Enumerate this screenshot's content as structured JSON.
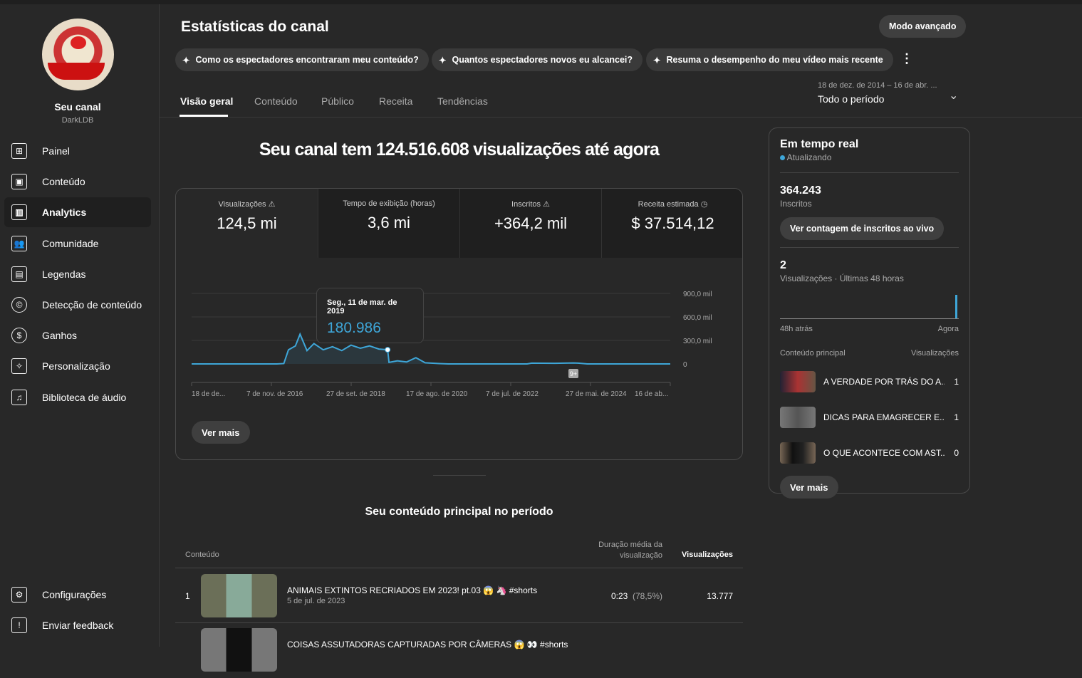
{
  "sidebar": {
    "channel_label": "Seu canal",
    "handle": "DarkLDB",
    "items": [
      {
        "label": "Painel",
        "icon": "dashboard-icon"
      },
      {
        "label": "Conteúdo",
        "icon": "content-icon"
      },
      {
        "label": "Analytics",
        "icon": "analytics-icon"
      },
      {
        "label": "Comunidade",
        "icon": "community-icon"
      },
      {
        "label": "Legendas",
        "icon": "subtitles-icon"
      },
      {
        "label": "Detecção de conteúdo",
        "icon": "copyright-icon"
      },
      {
        "label": "Ganhos",
        "icon": "dollar-icon"
      },
      {
        "label": "Personalização",
        "icon": "magic-wand-icon"
      },
      {
        "label": "Biblioteca de áudio",
        "icon": "audio-library-icon"
      }
    ],
    "bottom": [
      {
        "label": "Configurações",
        "icon": "gear-icon"
      },
      {
        "label": "Enviar feedback",
        "icon": "feedback-icon"
      }
    ]
  },
  "header": {
    "title": "Estatísticas do canal",
    "advanced": "Modo avançado",
    "chips": [
      "Como os espectadores encontraram meu conteúdo?",
      "Quantos espectadores novos eu alcancei?",
      "Resuma o desempenho do meu vídeo mais recente"
    ],
    "tabs": [
      "Visão geral",
      "Conteúdo",
      "Público",
      "Receita",
      "Tendências"
    ],
    "range_dates": "18 de dez. de 2014 – 16 de abr. ...",
    "range_label": "Todo o período"
  },
  "overview": {
    "headline": "Seu canal tem 124.516.608 visualizações até agora",
    "metrics": [
      {
        "label": "Visualizações",
        "value": "124,5 mi",
        "icon": "warning-icon"
      },
      {
        "label": "Tempo de exibição (horas)",
        "value": "3,6 mi"
      },
      {
        "label": "Inscritos",
        "value": "+364,2 mil",
        "icon": "warning-icon"
      },
      {
        "label": "Receita estimada",
        "value": "$ 37.514,12",
        "icon": "clock-icon"
      }
    ],
    "tooltip": {
      "date": "Seg., 11 de mar. de 2019",
      "value": "180.986"
    },
    "badge": "9+",
    "see_more": "Ver mais"
  },
  "chart_data": {
    "type": "line",
    "series_name": "Visualizações",
    "color": "#3ea6d8",
    "x_ticks": [
      "18 de de...",
      "7 de nov. de 2016",
      "27 de set. de 2018",
      "17 de ago. de 2020",
      "7 de jul. de 2022",
      "27 de mai. de 2024",
      "16 de ab..."
    ],
    "y_ticks": [
      "900,0 mil",
      "600,0 mil",
      "300,0 mil",
      "0"
    ],
    "ylim": [
      0,
      900000
    ],
    "xlim": [
      2014.96,
      2025.29
    ],
    "x": [
      2014.96,
      2016.8,
      2016.95,
      2017.05,
      2017.2,
      2017.3,
      2017.45,
      2017.6,
      2017.8,
      2018.0,
      2018.2,
      2018.4,
      2018.6,
      2018.8,
      2019.0,
      2019.19,
      2019.22,
      2019.4,
      2019.6,
      2019.8,
      2020.0,
      2020.3,
      2020.5,
      2022.2,
      2022.3,
      2022.8,
      2023.2,
      2023.3,
      2023.5,
      2025.29
    ],
    "y": [
      0,
      0,
      5000,
      180000,
      230000,
      380000,
      170000,
      260000,
      180000,
      220000,
      170000,
      240000,
      200000,
      230000,
      190000,
      180986,
      20000,
      40000,
      25000,
      80000,
      15000,
      5000,
      0,
      0,
      10000,
      8000,
      12000,
      10000,
      0,
      0
    ]
  },
  "realtime": {
    "title": "Em tempo real",
    "status": "Atualizando",
    "subs": "364.243",
    "subs_label": "Inscritos",
    "live_btn": "Ver contagem de inscritos ao vivo",
    "views": "2",
    "views_label": "Visualizações · Últimas 48 horas",
    "ago": "48h atrás",
    "now": "Agora",
    "top_label": "Conteúdo principal",
    "top_col": "Visualizações",
    "top": [
      {
        "title": "A VERDADE POR TRÁS DO A...",
        "views": "1"
      },
      {
        "title": "DICAS PARA EMAGRECER E...",
        "views": "1"
      },
      {
        "title": "O QUE ACONTECE COM AST...",
        "views": "0"
      }
    ],
    "see_more": "Ver mais"
  },
  "top_content": {
    "title": "Seu conteúdo principal no período",
    "col_content": "Conteúdo",
    "col_duration": "Duração média da visualização",
    "col_views": "Visualizações",
    "rows": [
      {
        "rank": "1",
        "title": "ANIMAIS EXTINTOS RECRIADOS EM 2023! pt.03 😱 🦄 #shorts",
        "date": "5 de jul. de 2023",
        "duration": "0:23",
        "pct": "(78,5%)",
        "views": "13.777"
      },
      {
        "title": "COISAS ASSUTADORAS CAPTURADAS POR CÂMERAS 😱 👀 #shorts"
      }
    ]
  }
}
